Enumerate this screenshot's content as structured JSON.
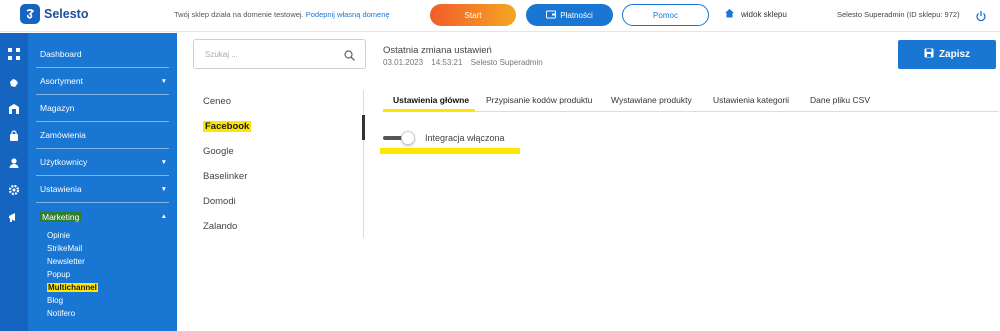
{
  "app": {
    "logo_text": "Selesto"
  },
  "topbar": {
    "domain_note": "Twój sklep działa na domenie testowej.",
    "domain_link": "Podepnij własną domenę",
    "start_label": "Start",
    "payments_label": "Płatności",
    "help_label": "Pomoc",
    "shop_view_label": "widok sklepu",
    "user_info": "Selesto Superadmin (ID sklepu: 972)"
  },
  "sidebar": {
    "items": [
      {
        "label": "Dashboard",
        "icon": "grid-icon"
      },
      {
        "label": "Asortyment",
        "icon": "hand-icon",
        "caret": "▼"
      },
      {
        "label": "Magazyn",
        "icon": "warehouse-icon"
      },
      {
        "label": "Zamówienia",
        "icon": "bag-icon"
      },
      {
        "label": "Użytkownicy",
        "icon": "user-icon",
        "caret": "▼"
      },
      {
        "label": "Ustawienia",
        "icon": "gear-icon",
        "caret": "▼"
      },
      {
        "label": "Marketing",
        "icon": "megaphone-icon",
        "caret": "▲",
        "highlighted": true
      }
    ],
    "marketing_sub": [
      {
        "label": "Opinie"
      },
      {
        "label": "StrikeMail"
      },
      {
        "label": "Newsletter"
      },
      {
        "label": "Popup"
      },
      {
        "label": "Multichannel",
        "active": true
      },
      {
        "label": "Blog"
      },
      {
        "label": "Notifero"
      }
    ]
  },
  "search": {
    "placeholder": "Szukaj ..."
  },
  "last_change": {
    "title": "Ostatnia zmiana ustawień",
    "date": "03.01.2023",
    "time": "14:53:21",
    "user": "Selesto Superadmin"
  },
  "save_label": "Zapisz",
  "channels": [
    {
      "label": "Ceneo"
    },
    {
      "label": "Facebook",
      "active": true
    },
    {
      "label": "Google"
    },
    {
      "label": "Baselinker"
    },
    {
      "label": "Domodi"
    },
    {
      "label": "Zalando"
    }
  ],
  "tabs": [
    {
      "label": "Ustawienia główne",
      "active": true
    },
    {
      "label": "Przypisanie kodów produktu"
    },
    {
      "label": "Wystawiane produkty"
    },
    {
      "label": "Ustawienia kategorii"
    },
    {
      "label": "Dane pliku CSV"
    }
  ],
  "integration": {
    "label": "Integracja włączona",
    "enabled": true
  },
  "colors": {
    "brand_blue": "#1976d2",
    "rail_blue": "#1565c0",
    "highlight_yellow": "#ffe600",
    "highlight_green": "#2e7d32",
    "start_gradient": [
      "#f25c2a",
      "#f5a623"
    ]
  }
}
